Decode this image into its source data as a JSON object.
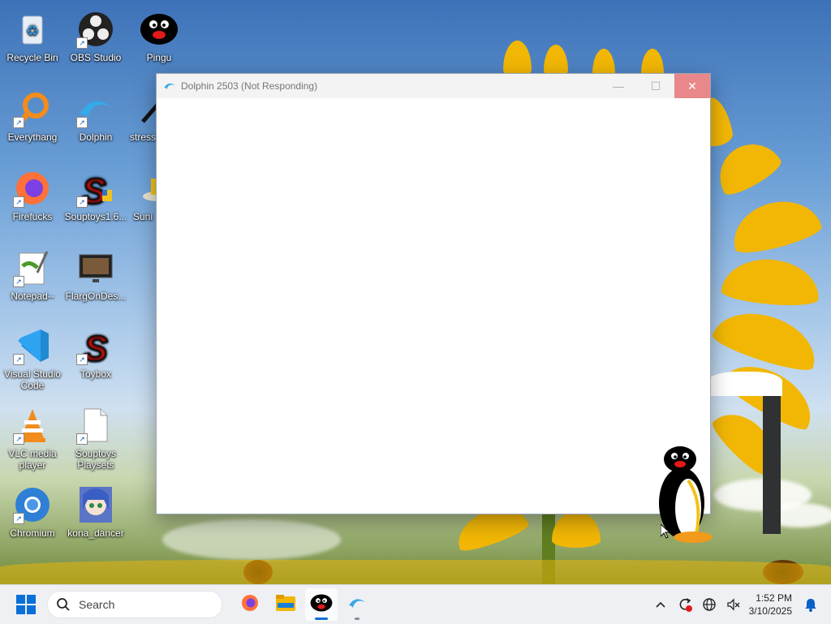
{
  "desktop": {
    "icons": [
      {
        "label": "Recycle Bin",
        "icon": "recycle-bin-icon"
      },
      {
        "label": "OBS Studio",
        "icon": "obs-icon"
      },
      {
        "label": "Pingu",
        "icon": "pingu-icon"
      },
      {
        "label": "Everythang",
        "icon": "everything-search-icon"
      },
      {
        "label": "Dolphin",
        "icon": "dolphin-icon"
      },
      {
        "label": "stress",
        "icon": "stress-icon"
      },
      {
        "label": "Firefucks",
        "icon": "firefox-icon"
      },
      {
        "label": "Souptoys1.6...",
        "icon": "souptoys-icon"
      },
      {
        "label": "Suni",
        "icon": "app-icon"
      },
      {
        "label": "Notepad--",
        "icon": "notepad-icon"
      },
      {
        "label": "FlargOnDes...",
        "icon": "video-icon"
      },
      {
        "label": "Visual Studio Code",
        "icon": "vscode-icon"
      },
      {
        "label": "Toybox",
        "icon": "toybox-icon"
      },
      {
        "label": "VLC media player",
        "icon": "vlc-icon"
      },
      {
        "label": "Souptoys Playsets",
        "icon": "file-icon"
      },
      {
        "label": "Chromium",
        "icon": "chromium-icon"
      },
      {
        "label": "kona_dancer",
        "icon": "anime-image-icon"
      }
    ]
  },
  "window": {
    "title": "Dolphin 2503 (Not Responding)",
    "icon": "dolphin-icon",
    "minimize": "—",
    "maximize": "☐",
    "close": "✕"
  },
  "taskbar": {
    "search_placeholder": "Search",
    "apps": [
      "firefox-icon",
      "file-explorer-icon",
      "pingu-icon",
      "dolphin-icon"
    ],
    "clock_time": "1:52 PM",
    "clock_date": "3/10/2025"
  },
  "colors": {
    "accent": "#0a6fd8",
    "close_hover": "#e8888a",
    "taskbar_bg": "#eef0f3"
  }
}
